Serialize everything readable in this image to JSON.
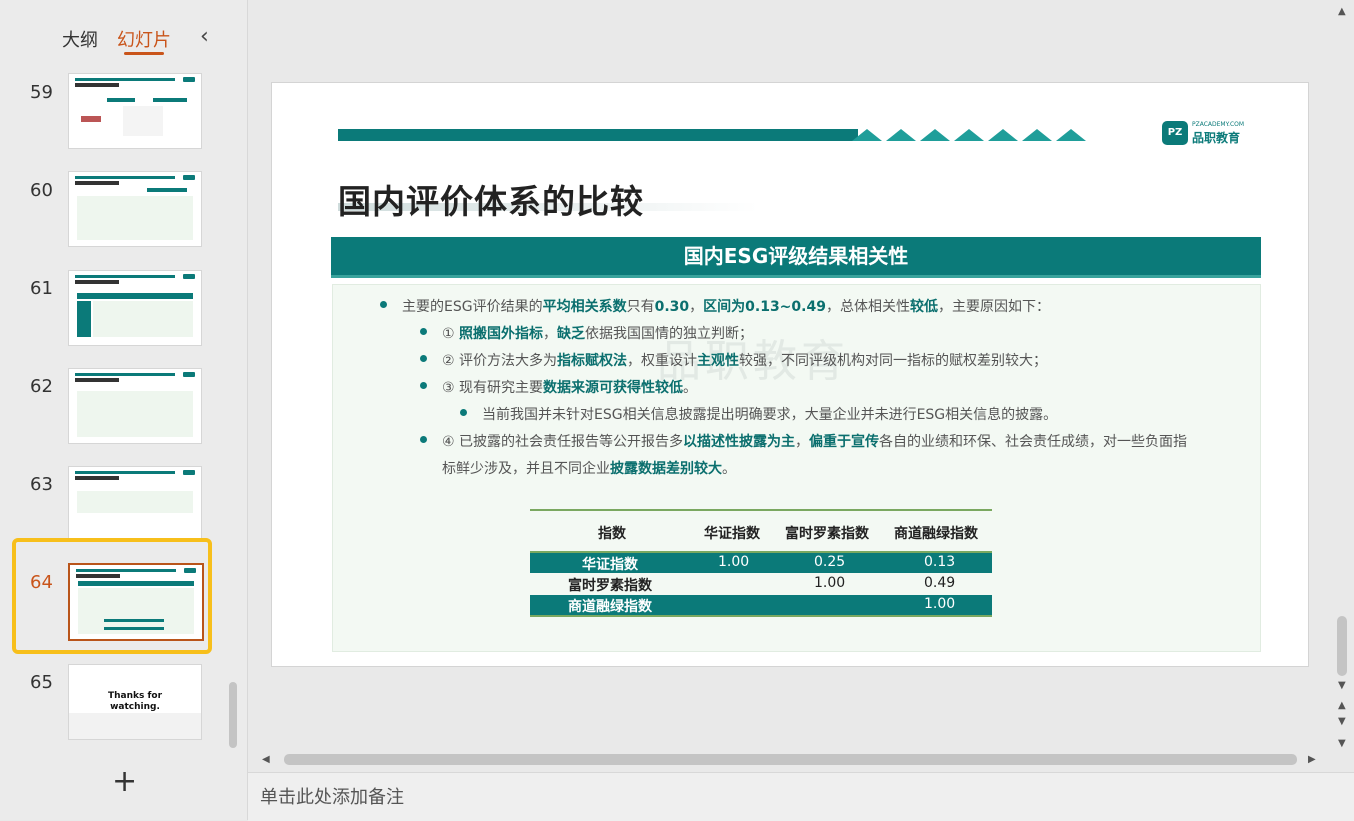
{
  "left_panel": {
    "tab_outline": "大纲",
    "tab_slides": "幻灯片",
    "collapse_icon": "chevron-left-icon",
    "add_icon": "plus-icon",
    "slides": [
      {
        "num": "59"
      },
      {
        "num": "60"
      },
      {
        "num": "61"
      },
      {
        "num": "62"
      },
      {
        "num": "63"
      },
      {
        "num": "64",
        "selected": true
      },
      {
        "num": "65",
        "thumb_text": "Thanks for watching."
      }
    ]
  },
  "slide": {
    "logo_small": "PZACADEMY.COM",
    "logo_mark": "PZ",
    "logo_name": "品职教育",
    "title": "国内评价体系的比较",
    "header": "国内ESG评级结果相关性",
    "watermark": "品职教育",
    "bullets": {
      "b1_a": "主要的ESG评价结果的",
      "b1_b": "平均相关系数",
      "b1_c": "只有",
      "b1_d": "0.30",
      "b1_e": "，",
      "b1_f": "区间为0.13~0.49",
      "b1_g": "，总体相关性",
      "b1_h": "较低",
      "b1_i": "，主要原因如下：",
      "b2_a": "① ",
      "b2_b": "照搬国外指标",
      "b2_c": "，",
      "b2_d": "缺乏",
      "b2_e": "依据我国国情的独立判断；",
      "b3_a": "② 评价方法大多为",
      "b3_b": "指标赋权法",
      "b3_c": "，权重设计",
      "b3_d": "主观性",
      "b3_e": "较强，不同评级机构对同一指标的赋权差别较大；",
      "b4_a": "③ 现有研究主要",
      "b4_b": "数据来源可获得性较低",
      "b4_c": "。",
      "b5": "当前我国并未针对ESG相关信息披露提出明确要求，大量企业并未进行ESG相关信息的披露。",
      "b6_a": "④ 已披露的社会责任报告等公开报告多",
      "b6_b": "以描述性披露为主",
      "b6_c": "，",
      "b6_d": "偏重于宣传",
      "b6_e": "各自的业绩和环保、社会责任成绩，对一些负面指",
      "b6_f": "标鲜少涉及，并且不同企业",
      "b6_g": "披露数据差别较大",
      "b6_h": "。"
    },
    "table": {
      "headers": [
        "指数",
        "华证指数",
        "富时罗素指数",
        "商道融绿指数"
      ],
      "rows": [
        [
          "华证指数",
          "1.00",
          "0.25",
          "0.13"
        ],
        [
          "富时罗素指数",
          "",
          "1.00",
          "0.49"
        ],
        [
          "商道融绿指数",
          "",
          "",
          "1.00"
        ]
      ]
    }
  },
  "notes": {
    "placeholder": "单击此处添加备注"
  },
  "colors": {
    "accent": "#0b7a79",
    "selection": "#f7bf1b",
    "active_tab": "#c9541a"
  }
}
